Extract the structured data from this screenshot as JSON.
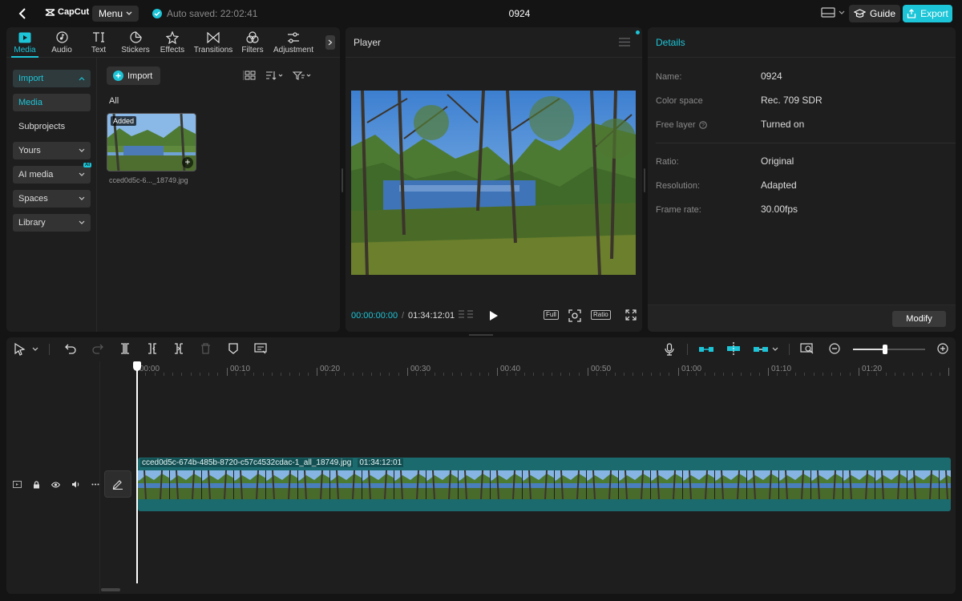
{
  "header": {
    "app_name": "CapCut",
    "menu_label": "Menu",
    "autosave_text": "Auto saved: 22:02:41",
    "project_title": "0924",
    "guide_label": "Guide",
    "export_label": "Export"
  },
  "toolbar_tabs": [
    {
      "label": "Media",
      "icon": "media-icon",
      "active": true
    },
    {
      "label": "Audio",
      "icon": "audio-icon"
    },
    {
      "label": "Text",
      "icon": "text-icon"
    },
    {
      "label": "Stickers",
      "icon": "stickers-icon"
    },
    {
      "label": "Effects",
      "icon": "effects-icon"
    },
    {
      "label": "Transitions",
      "icon": "transitions-icon"
    },
    {
      "label": "Filters",
      "icon": "filters-icon"
    },
    {
      "label": "Adjustment",
      "icon": "adjustment-icon"
    }
  ],
  "media_sidebar": {
    "items": [
      "Import",
      "Media",
      "Subprojects",
      "Yours",
      "AI media",
      "Spaces",
      "Library"
    ],
    "ai_badge": "AI"
  },
  "media_panel": {
    "import_button": "Import",
    "filter_label": "All",
    "thumbnail": {
      "badge": "Added",
      "filename": "cced0d5c-6..._18749.jpg"
    }
  },
  "player": {
    "title": "Player",
    "current_time": "00:00:00:00",
    "separator": "/",
    "duration": "01:34:12:01",
    "full_label": "Full",
    "ratio_label": "Ratio"
  },
  "details": {
    "title": "Details",
    "rows": [
      {
        "label": "Name:",
        "value": "0924"
      },
      {
        "label": "Color space",
        "value": "Rec. 709 SDR"
      },
      {
        "label": "Free layer",
        "value": "Turned on"
      },
      {
        "label": "Ratio:",
        "value": "Original"
      },
      {
        "label": "Resolution:",
        "value": "Adapted"
      },
      {
        "label": "Frame rate:",
        "value": "30.00fps"
      }
    ],
    "modify_label": "Modify"
  },
  "timeline": {
    "ruler_labels": [
      "00:00",
      "00:10",
      "00:20",
      "00:30",
      "00:40",
      "00:50",
      "01:00",
      "01:10",
      "01:20"
    ],
    "clip_name": "cced0d5c-674b-485b-8720-c57c4532cdac-1_all_18749.jpg",
    "clip_duration": "01:34:12:01",
    "zoom_level": 0.45
  },
  "colors": {
    "accent": "#1cc5d7",
    "clip": "#1a6a6e",
    "panel": "#1e1e1f",
    "background": "#141414"
  }
}
